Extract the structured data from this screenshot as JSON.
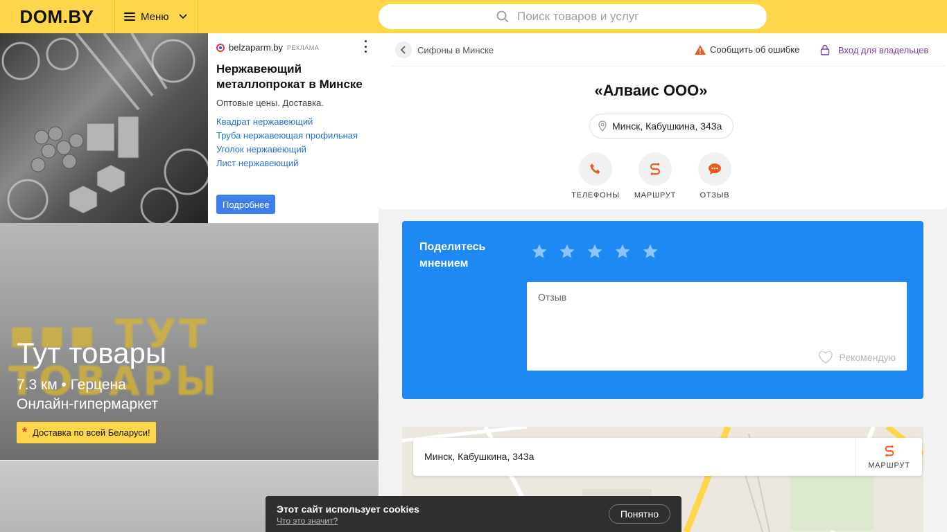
{
  "header": {
    "logo": "DOM.BY",
    "menu_label": "Меню",
    "search_placeholder": "Поиск товаров и услуг"
  },
  "ad": {
    "source": "belzaparm.by",
    "tag": "РЕКЛАМА",
    "title": "Нержавеющий металлопрокат в Минске",
    "description": "Оптовые цены. Доставка.",
    "links": [
      "Квадрат нержавеющий",
      "Труба нержавеющая профильная",
      "Уголок нержавеющий",
      "Лист нержавеющий"
    ],
    "button": "Подробнее"
  },
  "promo": {
    "brand_text": "▪▪▪ ТУТ ТОВАРЫ",
    "title": "Тут товары",
    "line1": "7.3 км • Герцена",
    "line2": "Онлайн-гипермаркет",
    "badge": "Доставка по всей Беларуси!"
  },
  "card": {
    "breadcrumb": "Сифоны в Минске",
    "report": "Сообщить об ошибке",
    "owner_login": "Вход для владельцев",
    "company": "«Алваис ООО»",
    "address": "Минск, Кабушкина, 343а",
    "actions": [
      {
        "label": "ТЕЛЕФОНЫ",
        "icon": "phone-icon"
      },
      {
        "label": "МАРШРУТ",
        "icon": "route-icon"
      },
      {
        "label": "ОТЗЫВ",
        "icon": "chat-bubble-icon"
      }
    ]
  },
  "review": {
    "title": "Поделитесь мнением",
    "rating_max": 5,
    "placeholder": "Отзыв",
    "recommend": "Рекомендую"
  },
  "map": {
    "address": "Минск, Кабушкина, 343а",
    "route_label": "МАРШРУТ"
  },
  "cookie": {
    "text": "Этот сайт использует cookies",
    "link": "Что это значит?",
    "button": "Понятно"
  },
  "colors": {
    "brand_yellow": "#ffd54a",
    "review_blue": "#1e88f3",
    "accent_orange": "#f05a22",
    "owner_purple": "#7a3eaa"
  }
}
